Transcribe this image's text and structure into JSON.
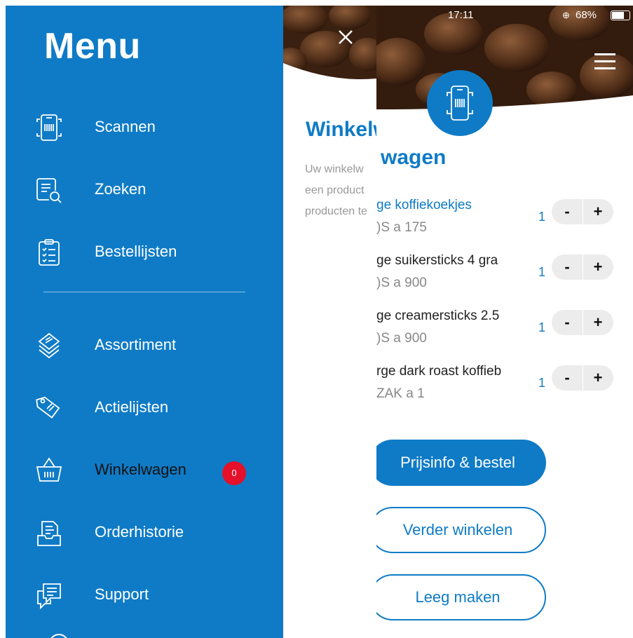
{
  "menu": {
    "title": "Menu",
    "items": [
      {
        "label": "Scannen",
        "icon": "scan-phone-icon"
      },
      {
        "label": "Zoeken",
        "icon": "search-list-icon"
      },
      {
        "label": "Bestellijsten",
        "icon": "clipboard-list-icon"
      },
      {
        "label": "Assortiment",
        "icon": "layers-icon"
      },
      {
        "label": "Actielijsten",
        "icon": "tags-icon"
      },
      {
        "label": "Winkelwagen",
        "icon": "basket-icon",
        "badge": "0"
      },
      {
        "label": "Orderhistorie",
        "icon": "order-history-icon"
      },
      {
        "label": "Support",
        "icon": "chat-icon"
      }
    ]
  },
  "background_page": {
    "title": "Winkelw",
    "desc_lines": [
      "Uw winkelw",
      "een product",
      "producten te"
    ]
  },
  "status_bar": {
    "time": "17:11",
    "battery": "68%"
  },
  "cart": {
    "title": "wagen",
    "items": [
      {
        "name": "ge koffiekoekjes",
        "sub": ")S a 175",
        "qty": "1"
      },
      {
        "name": "ge suikersticks 4 gra",
        "sub": ")S a 900",
        "qty": "1"
      },
      {
        "name": "ge creamersticks 2.5",
        "sub": ")S a 900",
        "qty": "1"
      },
      {
        "name": "rge dark roast koffieb",
        "sub": "ZAK a 1",
        "qty": "1"
      }
    ],
    "minus": "-",
    "plus": "+",
    "buttons": {
      "order": "Prijsinfo & bestel",
      "continue": "Verder winkelen",
      "empty": "Leeg maken"
    }
  },
  "colors": {
    "brand_blue": "#0f7bc6",
    "badge_red": "#e5102a"
  }
}
